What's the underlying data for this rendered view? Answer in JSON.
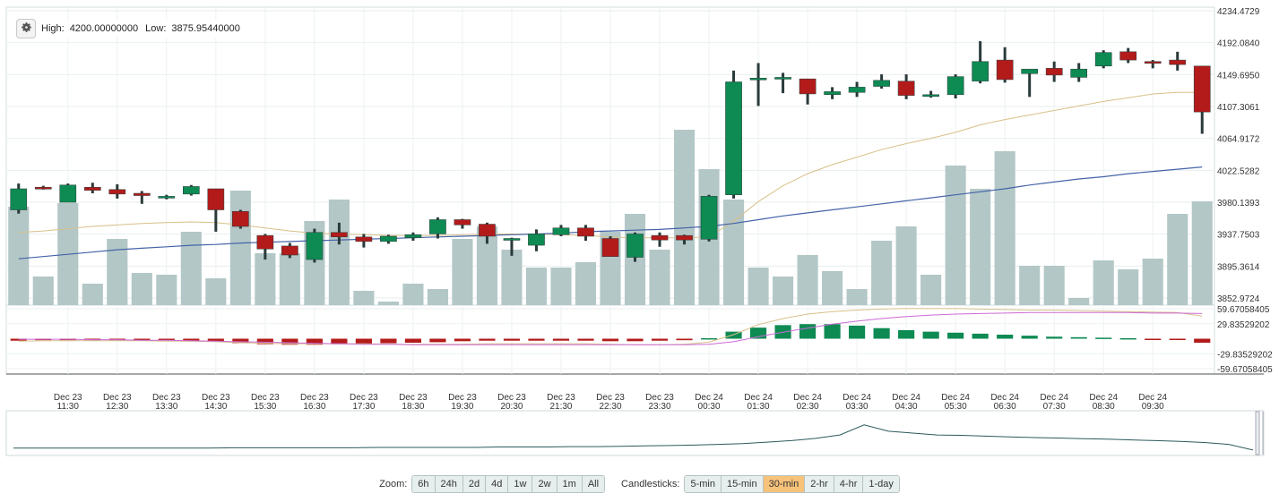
{
  "info": {
    "high_label": "High:",
    "high_value": "4200.00000000",
    "low_label": "Low:",
    "low_value": "3875.95440000"
  },
  "zoom": {
    "label": "Zoom:",
    "options": [
      "6h",
      "24h",
      "2d",
      "4d",
      "1w",
      "2w",
      "1m",
      "All"
    ]
  },
  "candlesticks": {
    "label": "Candlesticks:",
    "options": [
      "5-min",
      "15-min",
      "30-min",
      "2-hr",
      "4-hr",
      "1-day"
    ],
    "selected": "30-min"
  },
  "colors": {
    "up": "#0e8a53",
    "down": "#b31b1b",
    "volume": "#b3c7c7",
    "ma_short": "#d8c089",
    "ma_long": "#4463a8",
    "macd_line": "#d8c089",
    "signal_line": "#cc6ad6",
    "navigator": "#2e5a5a"
  },
  "chart_data": {
    "type": "candlestick",
    "price_axis": {
      "ticks": [
        "4234.4729",
        "4192.0840",
        "4149.6950",
        "4107.3061",
        "4064.9172",
        "4022.5282",
        "3980.1393",
        "3937.7503",
        "3895.3614",
        "3852.9724"
      ],
      "range": [
        3852.9724,
        4234.4729
      ]
    },
    "macd_axis": {
      "ticks": [
        "59.67058405",
        "29.83529202",
        "-29.83529202",
        "-59.67058405"
      ],
      "range": [
        -59.67058405,
        59.67058405
      ]
    },
    "x_labels": [
      {
        "date": "Dec 23",
        "time": "11:30",
        "index": 2
      },
      {
        "date": "Dec 23",
        "time": "12:30",
        "index": 4
      },
      {
        "date": "Dec 23",
        "time": "13:30",
        "index": 6
      },
      {
        "date": "Dec 23",
        "time": "14:30",
        "index": 8
      },
      {
        "date": "Dec 23",
        "time": "15:30",
        "index": 10
      },
      {
        "date": "Dec 23",
        "time": "16:30",
        "index": 12
      },
      {
        "date": "Dec 23",
        "time": "17:30",
        "index": 14
      },
      {
        "date": "Dec 23",
        "time": "18:30",
        "index": 16
      },
      {
        "date": "Dec 23",
        "time": "19:30",
        "index": 18
      },
      {
        "date": "Dec 23",
        "time": "20:30",
        "index": 20
      },
      {
        "date": "Dec 23",
        "time": "21:30",
        "index": 22
      },
      {
        "date": "Dec 23",
        "time": "22:30",
        "index": 24
      },
      {
        "date": "Dec 23",
        "time": "23:30",
        "index": 26
      },
      {
        "date": "Dec 24",
        "time": "00:30",
        "index": 28
      },
      {
        "date": "Dec 24",
        "time": "01:30",
        "index": 30
      },
      {
        "date": "Dec 24",
        "time": "02:30",
        "index": 32
      },
      {
        "date": "Dec 24",
        "time": "03:30",
        "index": 34
      },
      {
        "date": "Dec 24",
        "time": "04:30",
        "index": 36
      },
      {
        "date": "Dec 24",
        "time": "05:30",
        "index": 38
      },
      {
        "date": "Dec 24",
        "time": "06:30",
        "index": 40
      },
      {
        "date": "Dec 24",
        "time": "07:30",
        "index": 42
      },
      {
        "date": "Dec 24",
        "time": "08:30",
        "index": 44
      },
      {
        "date": "Dec 24",
        "time": "09:30",
        "index": 46
      }
    ],
    "candles": [
      {
        "o": 3970,
        "h": 4005,
        "l": 3965,
        "c": 3998,
        "v": 0.55
      },
      {
        "o": 4000,
        "h": 4002,
        "l": 3997,
        "c": 3999,
        "v": 0.15
      },
      {
        "o": 3980,
        "h": 4005,
        "l": 3990,
        "c": 4003,
        "v": 0.57
      },
      {
        "o": 4000,
        "h": 4006,
        "l": 3992,
        "c": 3996,
        "v": 0.08
      },
      {
        "o": 3997,
        "h": 4004,
        "l": 3985,
        "c": 3991,
        "v": 0.32
      },
      {
        "o": 3992,
        "h": 3995,
        "l": 3978,
        "c": 3989,
        "v": 0.18
      },
      {
        "o": 3988,
        "h": 3990,
        "l": 3984,
        "c": 3988,
        "v": 0.1
      },
      {
        "o": 3991,
        "h": 4003,
        "l": 3989,
        "c": 4001,
        "v": 0.22
      },
      {
        "o": 3998,
        "h": 3998,
        "l": 3941,
        "c": 3970,
        "v": 0.35
      },
      {
        "o": 3968,
        "h": 3970,
        "l": 3945,
        "c": 3948,
        "v": 0.5
      },
      {
        "o": 3936,
        "h": 3938,
        "l": 3904,
        "c": 3918,
        "v": 0.08
      },
      {
        "o": 3922,
        "h": 3926,
        "l": 3906,
        "c": 3910,
        "v": 0.29
      },
      {
        "o": 3904,
        "h": 3945,
        "l": 3900,
        "c": 3940,
        "v": 0.34
      },
      {
        "o": 3940,
        "h": 3953,
        "l": 3924,
        "c": 3934,
        "v": 0.57
      },
      {
        "o": 3934,
        "h": 3938,
        "l": 3920,
        "c": 3928,
        "v": 0.81
      },
      {
        "o": 3928,
        "h": 3937,
        "l": 3925,
        "c": 3935,
        "v": 0.11
      },
      {
        "o": 3933,
        "h": 3940,
        "l": 3929,
        "c": 3937,
        "v": 0.04
      },
      {
        "o": 3938,
        "h": 3960,
        "l": 3932,
        "c": 3957,
        "v": 0.14
      },
      {
        "o": 3957,
        "h": 3958,
        "l": 3945,
        "c": 3950,
        "v": 0.11
      },
      {
        "o": 3951,
        "h": 3953,
        "l": 3925,
        "c": 3935,
        "v": 0.66
      },
      {
        "o": 3931,
        "h": 3933,
        "l": 3909,
        "c": 3932,
        "v": 0.68
      },
      {
        "o": 3923,
        "h": 3944,
        "l": 3915,
        "c": 3938,
        "v": 0.45
      },
      {
        "o": 3937,
        "h": 3950,
        "l": 3935,
        "c": 3946,
        "v": 0.26
      },
      {
        "o": 3946,
        "h": 3950,
        "l": 3929,
        "c": 3935,
        "v": 0.43
      },
      {
        "o": 3932,
        "h": 3935,
        "l": 3908,
        "c": 3908,
        "v": 0.29
      },
      {
        "o": 3907,
        "h": 3940,
        "l": 3901,
        "c": 3938,
        "v": 0.56
      },
      {
        "o": 3936,
        "h": 3940,
        "l": 3921,
        "c": 3930,
        "v": 0.79
      },
      {
        "o": 3936,
        "h": 3937,
        "l": 3924,
        "c": 3930,
        "v": 0.61
      },
      {
        "o": 3931,
        "h": 3990,
        "l": 3928,
        "c": 3988,
        "v": 0.95
      },
      {
        "o": 3990,
        "h": 4155,
        "l": 3985,
        "c": 4140,
        "v": 1.12
      },
      {
        "o": 4145,
        "h": 4165,
        "l": 4108,
        "c": 4145,
        "v": 0.83
      },
      {
        "o": 4146,
        "h": 4152,
        "l": 4125,
        "c": 4146,
        "v": 1.18
      },
      {
        "o": 4144,
        "h": 4144,
        "l": 4110,
        "c": 4124,
        "v": 0.3
      },
      {
        "o": 4123,
        "h": 4133,
        "l": 4117,
        "c": 4127,
        "v": 0.38
      },
      {
        "o": 4126,
        "h": 4140,
        "l": 4120,
        "c": 4133,
        "v": 0.27
      },
      {
        "o": 4134,
        "h": 4150,
        "l": 4131,
        "c": 4142,
        "v": 0.69
      },
      {
        "o": 4141,
        "h": 4150,
        "l": 4117,
        "c": 4122,
        "v": 0.69
      },
      {
        "o": 4122,
        "h": 4128,
        "l": 4119,
        "c": 4123,
        "v": 0.27
      },
      {
        "o": 4123,
        "h": 4150,
        "l": 4118,
        "c": 4147,
        "v": 0.39
      },
      {
        "o": 4141,
        "h": 4194,
        "l": 4138,
        "c": 4167,
        "v": 1.07
      },
      {
        "o": 4169,
        "h": 4186,
        "l": 4139,
        "c": 4143,
        "v": 0.73
      },
      {
        "o": 4151,
        "h": 4156,
        "l": 4120,
        "c": 4157,
        "v": 1.45
      },
      {
        "o": 4158,
        "h": 4167,
        "l": 4140,
        "c": 4149,
        "v": 0.29
      },
      {
        "o": 4146,
        "h": 4165,
        "l": 4140,
        "c": 4157,
        "v": 0.29
      },
      {
        "o": 4161,
        "h": 4182,
        "l": 4158,
        "c": 4179,
        "v": 0.25
      },
      {
        "o": 4180,
        "h": 4185,
        "l": 4165,
        "c": 4169,
        "v": 0.17
      },
      {
        "o": 4167,
        "h": 4169,
        "l": 4158,
        "c": 4166,
        "v": 0.21
      },
      {
        "o": 4169,
        "h": 4180,
        "l": 4155,
        "c": 4163,
        "v": 0.34
      },
      {
        "o": 4161,
        "h": 4161,
        "l": 4071,
        "c": 4100,
        "v": 0.34
      }
    ],
    "volumes": [
      0.55,
      0.16,
      0.57,
      0.12,
      0.37,
      0.18,
      0.17,
      0.41,
      0.15,
      0.64,
      0.29,
      0.29,
      0.47,
      0.59,
      0.08,
      0.02,
      0.12,
      0.09,
      0.37,
      0.44,
      0.31,
      0.21,
      0.21,
      0.24,
      0.41,
      0.51,
      0.31,
      0.98,
      0.76,
      0.59,
      0.21,
      0.16,
      0.28,
      0.19,
      0.09,
      0.36,
      0.44,
      0.17,
      0.78,
      0.65,
      0.86,
      0.22,
      0.22,
      0.04,
      0.25,
      0.2,
      0.26,
      0.51,
      0.58
    ],
    "ma_short": [
      3940,
      3942,
      3945,
      3948,
      3950,
      3952,
      3953,
      3954,
      3953,
      3950,
      3946,
      3942,
      3939,
      3938,
      3937,
      3936,
      3936,
      3936,
      3937,
      3938,
      3938,
      3938,
      3937,
      3936,
      3934,
      3933,
      3933,
      3933,
      3934,
      3955,
      3981,
      4002,
      4018,
      4030,
      4040,
      4050,
      4058,
      4065,
      4073,
      4083,
      4090,
      4096,
      4102,
      4108,
      4114,
      4119,
      4124,
      4126,
      4126
    ],
    "ma_long": [
      3905,
      3908,
      3911,
      3914,
      3917,
      3919,
      3921,
      3923,
      3924,
      3926,
      3927,
      3928,
      3929,
      3930,
      3931,
      3932,
      3933,
      3934,
      3935,
      3936,
      3937,
      3938,
      3939,
      3941,
      3942,
      3943,
      3944,
      3946,
      3948,
      3952,
      3957,
      3962,
      3966,
      3970,
      3974,
      3978,
      3982,
      3986,
      3990,
      3994,
      3998,
      4003,
      4007,
      4011,
      4014,
      4018,
      4021,
      4024,
      4027
    ],
    "macd_hist": [
      -4,
      -3,
      -3,
      -3,
      -3,
      -3,
      -3,
      -4,
      -6,
      -9,
      -11,
      -12,
      -12,
      -11,
      -10,
      -9,
      -8,
      -7,
      -5,
      -4,
      -4,
      -4,
      -4,
      -4,
      -5,
      -5,
      -4,
      -3,
      1,
      14,
      22,
      27,
      29,
      29,
      26,
      21,
      17,
      14,
      12,
      10,
      8,
      6,
      4,
      3,
      2,
      1,
      -1,
      -2,
      -8
    ],
    "macd_line": [
      -5,
      -4,
      -4,
      -4,
      -4,
      -4,
      -5,
      -5,
      -6,
      -8,
      -9,
      -10,
      -10,
      -10,
      -10,
      -11,
      -11,
      -11,
      -11,
      -10,
      -10,
      -10,
      -10,
      -10,
      -11,
      -12,
      -12,
      -11,
      -7,
      8,
      28,
      40,
      49,
      54,
      57,
      59,
      60,
      60,
      60,
      59,
      58,
      57,
      57,
      56,
      55,
      54,
      53,
      52,
      45
    ],
    "signal_line": [
      -1,
      -1,
      -1,
      -2,
      -2,
      -3,
      -3,
      -4,
      -5,
      -6,
      -7,
      -8,
      -9,
      -10,
      -11,
      -11,
      -12,
      -12,
      -12,
      -12,
      -12,
      -12,
      -12,
      -12,
      -12,
      -12,
      -12,
      -12,
      -11,
      -6,
      4,
      13,
      21,
      29,
      35,
      40,
      44,
      47,
      49,
      50,
      51,
      52,
      52,
      52,
      52,
      52,
      51,
      51,
      50
    ],
    "navigator": [
      0.1,
      0.1,
      0.1,
      0.1,
      0.1,
      0.1,
      0.1,
      0.1,
      0.1,
      0.11,
      0.11,
      0.11,
      0.11,
      0.11,
      0.11,
      0.12,
      0.12,
      0.12,
      0.12,
      0.12,
      0.13,
      0.13,
      0.13,
      0.14,
      0.14,
      0.15,
      0.16,
      0.17,
      0.18,
      0.2,
      0.22,
      0.26,
      0.3,
      0.36,
      0.45,
      0.72,
      0.55,
      0.5,
      0.45,
      0.44,
      0.42,
      0.4,
      0.38,
      0.37,
      0.35,
      0.34,
      0.32,
      0.3,
      0.28,
      0.25,
      0.2,
      0.05
    ]
  }
}
